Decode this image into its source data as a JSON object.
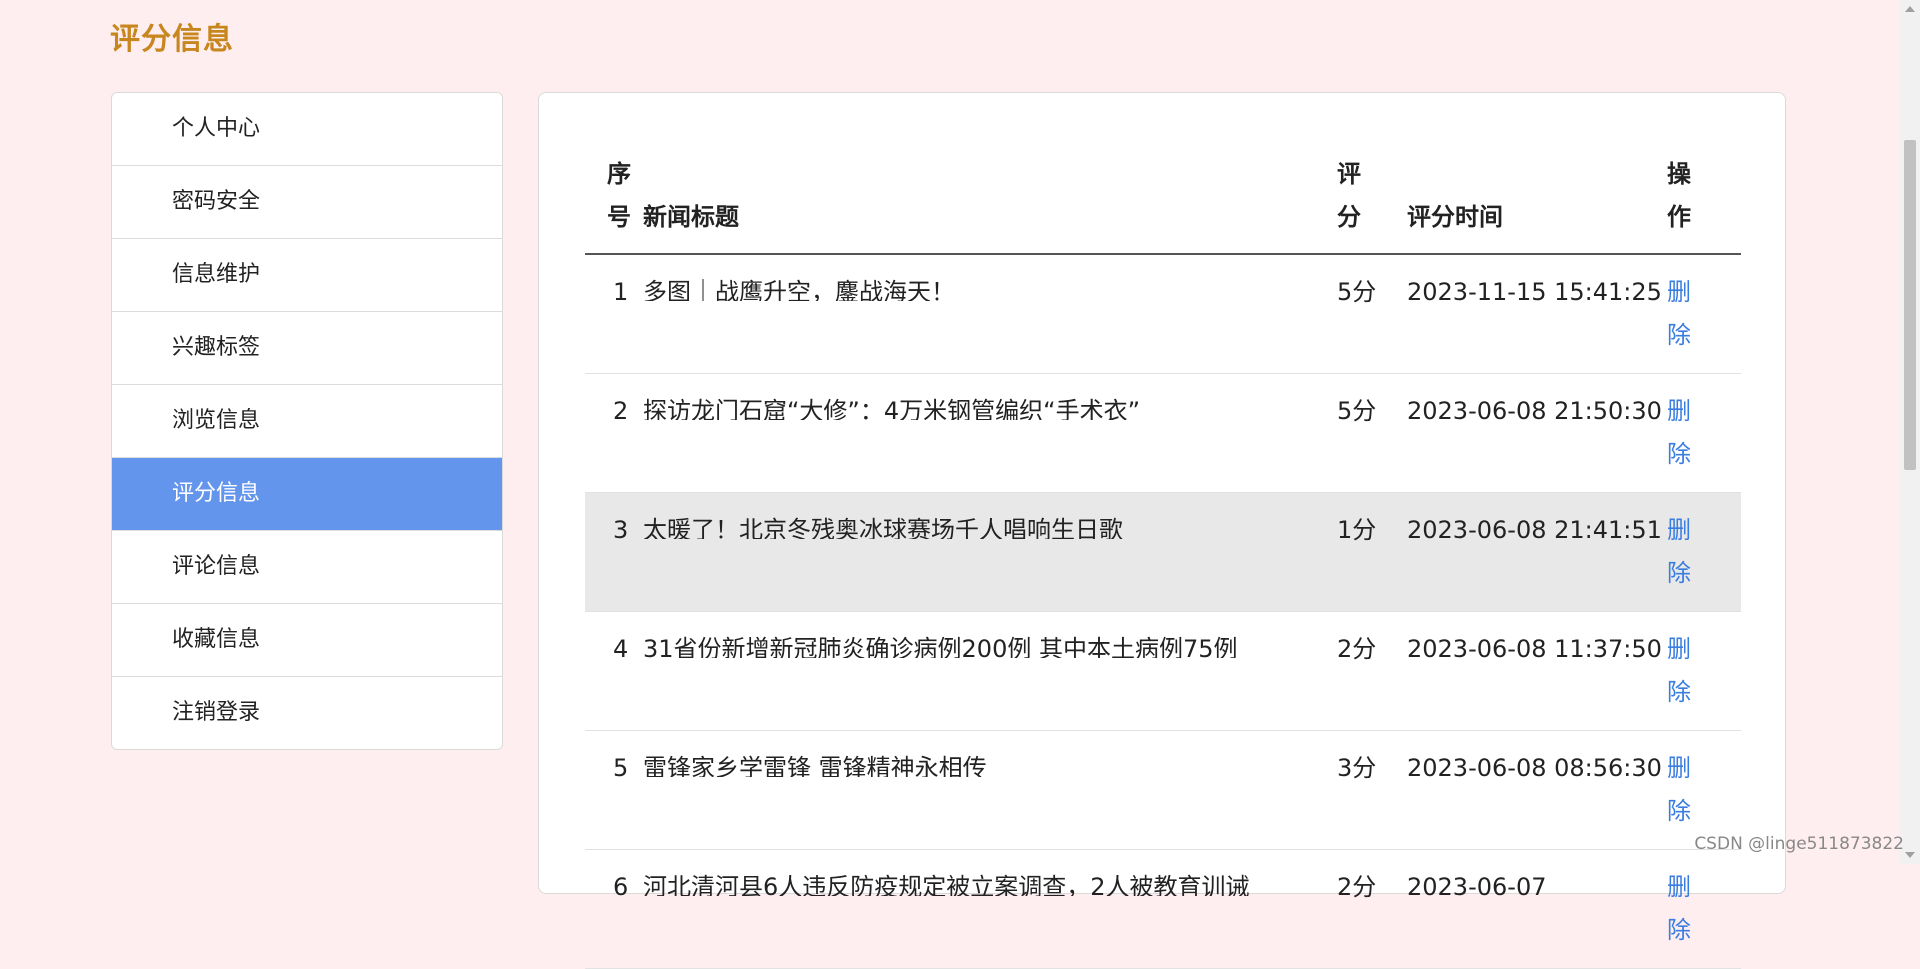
{
  "page_title": "评分信息",
  "sidebar": {
    "items": [
      {
        "label": "个人中心"
      },
      {
        "label": "密码安全"
      },
      {
        "label": "信息维护"
      },
      {
        "label": "兴趣标签"
      },
      {
        "label": "浏览信息"
      },
      {
        "label": "评分信息",
        "active": true
      },
      {
        "label": "评论信息"
      },
      {
        "label": "收藏信息"
      },
      {
        "label": "注销登录"
      }
    ]
  },
  "table": {
    "headers": {
      "index": "序号",
      "title": "新闻标题",
      "score": "评分",
      "time": "评分时间",
      "op": "操作"
    },
    "rows": [
      {
        "index": "1",
        "title": "多图｜战鹰升空，鏖战海天！",
        "score": "5分",
        "time": "2023-11-15 15:41:25",
        "op": "删除"
      },
      {
        "index": "2",
        "title": "探访龙门石窟“大修”：4万米钢管编织“手术衣”",
        "score": "5分",
        "time": "2023-06-08 21:50:30",
        "op": "删除"
      },
      {
        "index": "3",
        "title": "太暖了！北京冬残奥冰球赛场千人唱响生日歌",
        "score": "1分",
        "time": "2023-06-08 21:41:51",
        "op": "删除"
      },
      {
        "index": "4",
        "title": "31省份新增新冠肺炎确诊病例200例 其中本土病例75例",
        "score": "2分",
        "time": "2023-06-08 11:37:50",
        "op": "删除"
      },
      {
        "index": "5",
        "title": "雷锋家乡学雷锋 雷锋精神永相传",
        "score": "3分",
        "time": "2023-06-08 08:56:30",
        "op": "删除"
      },
      {
        "index": "6",
        "title": "河北清河县6人违反防疫规定被立案调查，2人被教育训诫",
        "score": "2分",
        "time": "2023-06-07",
        "op": "删除"
      }
    ]
  },
  "watermark": "CSDN @linge511873822"
}
